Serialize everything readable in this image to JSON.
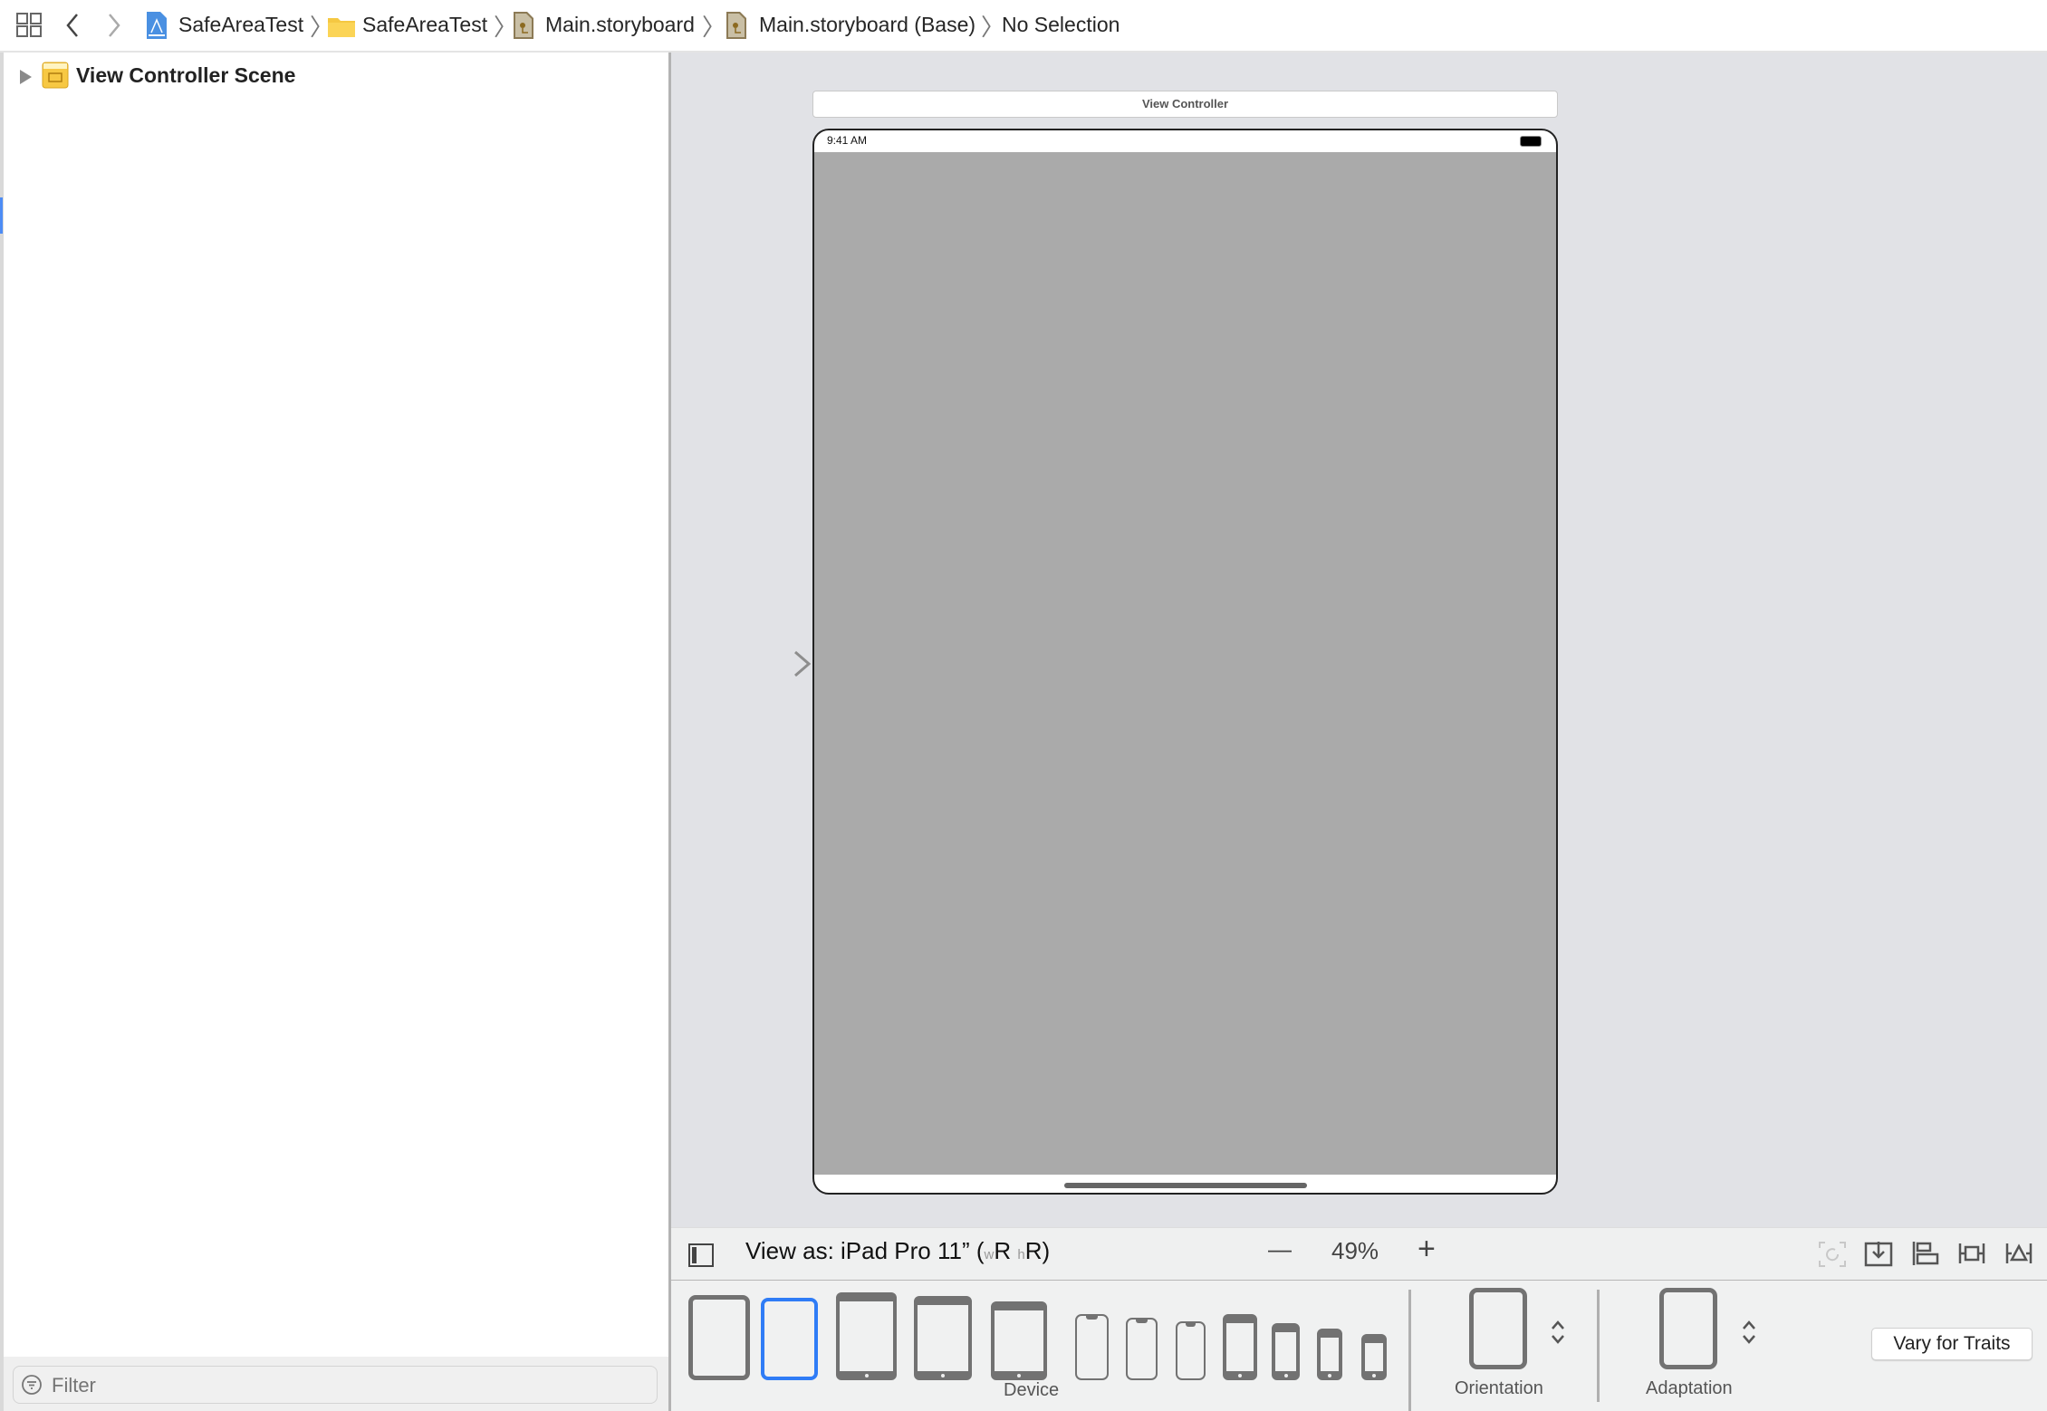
{
  "header": {
    "breadcrumbs": [
      {
        "label": "SafeAreaTest",
        "icon": "xcode-project-icon"
      },
      {
        "label": "SafeAreaTest",
        "icon": "folder-icon"
      },
      {
        "label": "Main.storyboard",
        "icon": "storyboard-file-icon"
      },
      {
        "label": "Main.storyboard (Base)",
        "icon": "storyboard-file-icon"
      },
      {
        "label": "No Selection",
        "icon": ""
      }
    ]
  },
  "sidebar": {
    "items": [
      {
        "label": "View Controller Scene",
        "expanded": false
      }
    ],
    "filter": {
      "placeholder": "Filter",
      "value": ""
    }
  },
  "canvas": {
    "scene_title": "View Controller",
    "status_time": "9:41 AM",
    "content_color": "#aaaaaa"
  },
  "toolbar": {
    "view_as_prefix": "View as: iPad Pro 11” (",
    "w_label": "w",
    "w_value": "R",
    "h_label": "h",
    "h_value": "R",
    "suffix": ")",
    "zoom_out": "—",
    "zoom_level": "49%",
    "zoom_in": "+"
  },
  "device_bar": {
    "device_label": "Device",
    "selected_device_index": 1,
    "orientation_label": "Orientation",
    "adaptation_label": "Adaptation",
    "vary_button": "Vary for Traits"
  },
  "colors": {
    "accent": "#2f7cf6",
    "canvas_bg": "#e1e2e6"
  }
}
